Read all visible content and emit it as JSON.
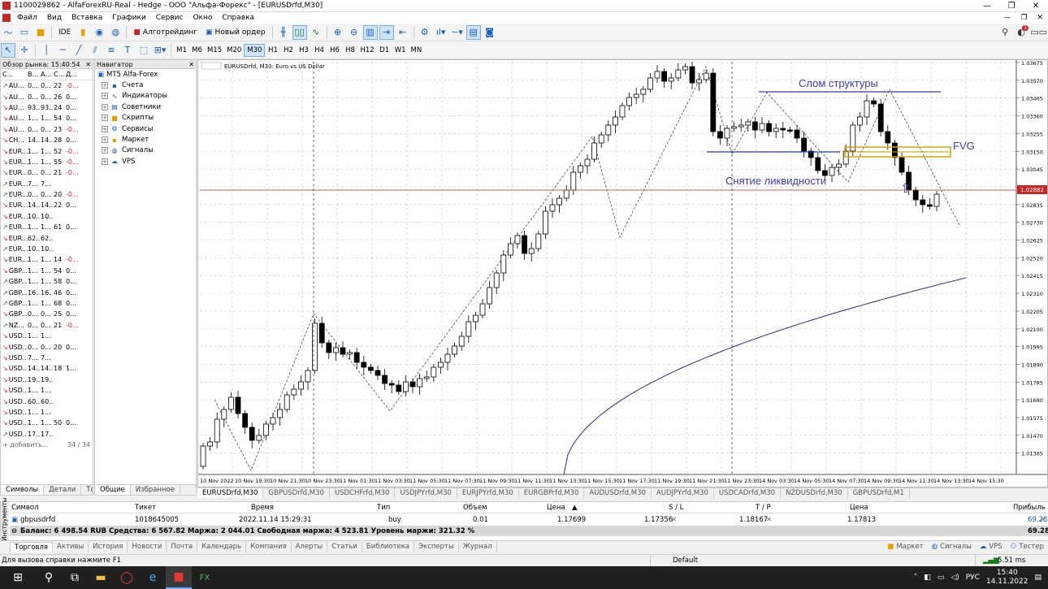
{
  "window": {
    "title": "1100029862 - AlfaForexRU-Real - Hedge - ООО \"Альфа-Форекс\" - [EURUSDrfd,M30]",
    "min": "—",
    "max": "❐",
    "close": "✕"
  },
  "menu": [
    "Файл",
    "Вид",
    "Вставка",
    "Графики",
    "Сервис",
    "Окно",
    "Справка"
  ],
  "toolbar": {
    "ide": "IDE",
    "algotrading": "Алготрейдинг",
    "new_order": "Новый ордер",
    "notification_count": "1"
  },
  "timeframes": [
    "M1",
    "M6",
    "M15",
    "M20",
    "M30",
    "H1",
    "H2",
    "H3",
    "H4",
    "H6",
    "H8",
    "H12",
    "D1",
    "W1",
    "MN"
  ],
  "active_timeframe": "M30",
  "market_watch": {
    "title": "Обзор рынка: 15:40:54",
    "columns": [
      "С...",
      "В...",
      "А...",
      "С...",
      "Д..."
    ],
    "rows": [
      {
        "s": "AU...",
        "b": "0...",
        "a": "0...",
        "sp": "22",
        "c": "-0...",
        "dir": "up"
      },
      {
        "s": "AU...",
        "b": "0...",
        "a": "0...",
        "sp": "26",
        "c": "0...",
        "dir": "dn"
      },
      {
        "s": "AU...",
        "b": "93...",
        "a": "93...",
        "sp": "24",
        "c": "0...",
        "dir": "dn"
      },
      {
        "s": "AU...",
        "b": "1...",
        "a": "1...",
        "sp": "54",
        "c": "0...",
        "dir": "dn"
      },
      {
        "s": "AU...",
        "b": "0...",
        "a": "0...",
        "sp": "23",
        "c": "-0...",
        "dir": "dn"
      },
      {
        "s": "CH...",
        "b": "14...",
        "a": "14...",
        "sp": "28",
        "c": "0...",
        "dir": "dn"
      },
      {
        "s": "EUR...",
        "b": "1...",
        "a": "1...",
        "sp": "52",
        "c": "-0...",
        "dir": "dn"
      },
      {
        "s": "EUR...",
        "b": "1...",
        "a": "1...",
        "sp": "55",
        "c": "-0...",
        "dir": "dn"
      },
      {
        "s": "EUR...",
        "b": "0...",
        "a": "0...",
        "sp": "21",
        "c": "-0...",
        "dir": "dn"
      },
      {
        "s": "EUR...",
        "b": "7...",
        "a": "7...",
        "sp": "",
        "c": "",
        "dir": "up"
      },
      {
        "s": "EUR...",
        "b": "0...",
        "a": "0...",
        "sp": "20",
        "c": "-0...",
        "dir": "up"
      },
      {
        "s": "EUR...",
        "b": "14...",
        "a": "14...",
        "sp": "22",
        "c": "0...",
        "dir": "dn"
      },
      {
        "s": "EUR...",
        "b": "10...",
        "a": "10...",
        "sp": "",
        "c": "",
        "dir": "dn"
      },
      {
        "s": "EUR...",
        "b": "1...",
        "a": "1...",
        "sp": "61",
        "c": "0...",
        "dir": "up"
      },
      {
        "s": "EUR...",
        "b": "62...",
        "a": "62...",
        "sp": "",
        "c": "",
        "dir": "dn"
      },
      {
        "s": "EUR...",
        "b": "10...",
        "a": "10...",
        "sp": "",
        "c": "",
        "dir": "up"
      },
      {
        "s": "EUR...",
        "b": "1...",
        "a": "1...",
        "sp": "14",
        "c": "-0...",
        "dir": "dn"
      },
      {
        "s": "GBP...",
        "b": "1...",
        "a": "1...",
        "sp": "54",
        "c": "0...",
        "dir": "dn"
      },
      {
        "s": "GBP...",
        "b": "1...",
        "a": "1...",
        "sp": "58",
        "c": "0...",
        "dir": "up"
      },
      {
        "s": "GBP...",
        "b": "16...",
        "a": "16...",
        "sp": "46",
        "c": "0...",
        "dir": "up"
      },
      {
        "s": "GBP...",
        "b": "1...",
        "a": "1...",
        "sp": "68",
        "c": "0...",
        "dir": "up"
      },
      {
        "s": "GBP...",
        "b": "0...",
        "a": "0...",
        "sp": "25",
        "c": "0...",
        "dir": "dn"
      },
      {
        "s": "NZ...",
        "b": "0...",
        "a": "0...",
        "sp": "21",
        "c": "-0...",
        "dir": "up"
      },
      {
        "s": "USD...",
        "b": "1...",
        "a": "1...",
        "sp": "",
        "c": "",
        "dir": "dn"
      },
      {
        "s": "USD...",
        "b": "0...",
        "a": "0...",
        "sp": "20",
        "c": "0...",
        "dir": "dn"
      },
      {
        "s": "USD...",
        "b": "7...",
        "a": "7...",
        "sp": "",
        "c": "",
        "dir": "dn"
      },
      {
        "s": "USD...",
        "b": "14...",
        "a": "14...",
        "sp": "18",
        "c": "1...",
        "dir": "dn"
      },
      {
        "s": "USD...",
        "b": "19...",
        "a": "19...",
        "sp": "",
        "c": "",
        "dir": "dn"
      },
      {
        "s": "USD...",
        "b": "1...",
        "a": "1...",
        "sp": "",
        "c": "",
        "dir": "dn"
      },
      {
        "s": "USD...",
        "b": "60...",
        "a": "60...",
        "sp": "",
        "c": "",
        "dir": "dn"
      },
      {
        "s": "USD...",
        "b": "1...",
        "a": "1...",
        "sp": "",
        "c": "",
        "dir": "dn"
      },
      {
        "s": "USD...",
        "b": "1...",
        "a": "1...",
        "sp": "50",
        "c": "0...",
        "dir": "dn"
      },
      {
        "s": "USD...",
        "b": "17...",
        "a": "17...",
        "sp": "",
        "c": "",
        "dir": "up"
      }
    ],
    "add_label": "+ добавить...",
    "count": "34 / 34",
    "tabs": [
      "Символы",
      "Детали",
      "Тор"
    ]
  },
  "navigator": {
    "title": "Навигатор",
    "root": "MT5 Alfa-Forex",
    "items": [
      "Счета",
      "Индикаторы",
      "Советники",
      "Скрипты",
      "Сервисы",
      "Маркет",
      "Сигналы",
      "VPS"
    ],
    "tabs": [
      "Общие",
      "Избранное"
    ]
  },
  "chart": {
    "header": "EURUSDrfd, M30:  Euro vs US Dollar",
    "annotations": {
      "structure_break": "Слом структуры",
      "fvg": "FVG",
      "liquidity": "Снятие ликвидности"
    },
    "price_labels": [
      "1.03675",
      "1.03570",
      "1.03465",
      "1.03360",
      "1.03255",
      "1.03150",
      "1.03045",
      "1.02940",
      "1.02835",
      "1.02730",
      "1.02625",
      "1.02520",
      "1.02415",
      "1.02310",
      "1.02205",
      "1.02100",
      "1.01995",
      "1.01890",
      "1.01785",
      "1.01680",
      "1.01575",
      "1.01470",
      "1.01365"
    ],
    "time_labels": [
      "10 Nov 2022",
      "10 Nov 19:30",
      "10 Nov 21:30",
      "10 Nov 23:30",
      "11 Nov 01:30",
      "11 Nov 03:30",
      "11 Nov 05:30",
      "11 Nov 07:30",
      "11 Nov 09:30",
      "11 Nov 11:30",
      "11 Nov 13:30",
      "11 Nov 15:30",
      "11 Nov 17:30",
      "11 Nov 19:30",
      "11 Nov 21:30",
      "11 Nov 23:30",
      "14 Nov 03:30",
      "14 Nov 05:30",
      "14 Nov 07:30",
      "14 Nov 09:30",
      "14 Nov 11:30",
      "14 Nov 13:30",
      "14 Nov 15:30"
    ],
    "current_price": "1.02882",
    "current_price_bg": "#c62828"
  },
  "chart_tabs": [
    "EURUSDrfd,M30",
    "GBPUSDrfd,M30",
    "USDCHFrfd,M30",
    "USDJPYrfd,M30",
    "EURJPYrfd,M30",
    "EURGBPrfd,M30",
    "AUDUSDrfd,M30",
    "AUDJPYrfd,M30",
    "USDCADrfd,M30",
    "NZDUSDrfd,M30",
    "GBPUSDrfd,M1"
  ],
  "terminal": {
    "side_label": "Инструменты",
    "columns": {
      "symbol": "Символ",
      "ticket": "Тикет",
      "time": "Время",
      "type": "Тип",
      "volume": "Объем",
      "price": "Цена",
      "sl": "S / L",
      "tp": "T / P",
      "cur_price": "Цена",
      "profit": "Прибыль"
    },
    "position": {
      "symbol": "gbpusdrfd",
      "ticket": "1018645005",
      "time": "2022.11.14 15:29:31",
      "type": "buy",
      "volume": "0.01",
      "price": "1.17699",
      "sl": "1.17356",
      "tp": "1.18167",
      "cur_price": "1.17813",
      "profit": "69.28"
    },
    "balance_line": "Баланс: 6 498.54 RUB  Средства: 6 567.82  Маржа: 2 044.01  Свободная маржа: 4 523.81  Уровень маржи: 321.32 %",
    "total_profit": "69.28",
    "tabs": [
      "Торговля",
      "Активы",
      "История",
      "Новости",
      "Почта",
      "Календарь",
      "Компания",
      "Алерты",
      "Статьи",
      "Библиотека",
      "Эксперты",
      "Журнал"
    ],
    "right": [
      "Маркет",
      "Сигналы",
      "VPS",
      "Тестер"
    ]
  },
  "status": {
    "help": "Для вызова справки нажмите F1",
    "profile": "Default",
    "ping": "5.51 ms"
  },
  "taskbar": {
    "lang": "РУС",
    "time": "15:40",
    "date": "14.11.2022"
  }
}
